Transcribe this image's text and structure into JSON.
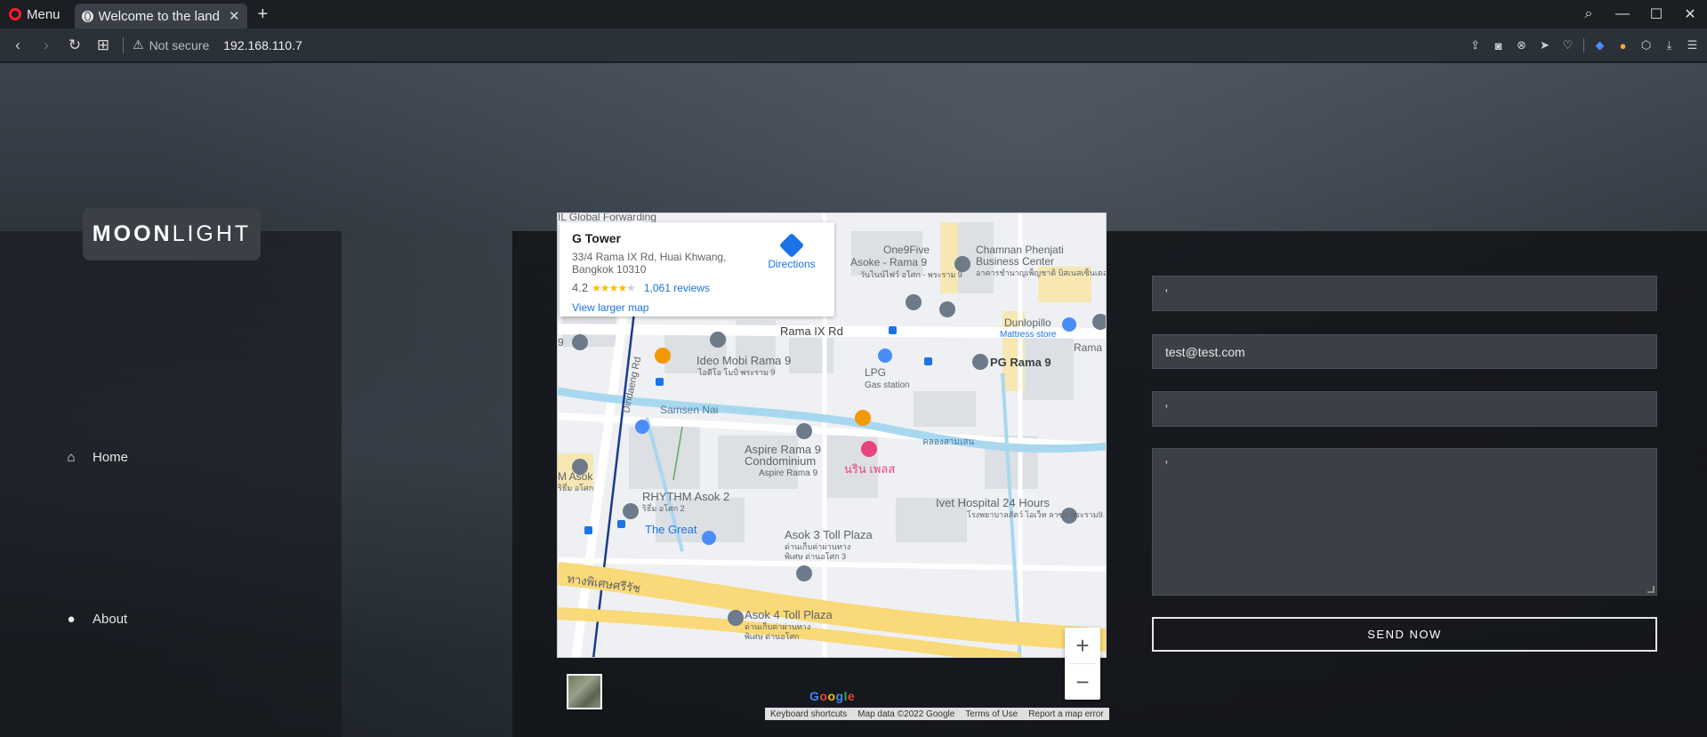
{
  "browser": {
    "menu_label": "Menu",
    "tab_title": "Welcome to the land",
    "security_label": "Not secure",
    "url": "192.168.110.7"
  },
  "site": {
    "brand_bold": "MOON",
    "brand_light": "LIGHT",
    "nav": [
      {
        "label": "Home",
        "icon": "home-icon"
      },
      {
        "label": "About",
        "icon": "user-icon"
      }
    ]
  },
  "map": {
    "place_title": "G Tower",
    "address": "33/4 Rama IX Rd, Huai Khwang, Bangkok 10310",
    "rating": "4.2",
    "stars": 4,
    "reviews": "1,061 reviews",
    "directions_label": "Directions",
    "larger_map_label": "View larger map",
    "labels": {
      "global_forwarding": "IL Global Forwarding",
      "one9five": "One9Five",
      "asoke_rama9": "Asoke - Rama 9",
      "asoke_rama9_th": "วันไนน์ไฟว์ อโศก - พระราม 9",
      "chamnan": "Chamnan Phenjati",
      "business_center": "Business Center",
      "chamnan_th": "อาคารชำนาญเพ็ญชาติ บิสเนสเซ็นเตอร์",
      "dunlopillo": "Dunlopillo",
      "mattress": "Mattress store",
      "rama9_rd": "Rama IX Rd",
      "rama": "Rama",
      "ideo": "Ideo Mobi Rama 9",
      "ideo_th": "ไอดีโอ โมบิ พระราม 9",
      "lpg": "LPG",
      "gas_station": "Gas station",
      "pg_rama9": "PG Rama 9",
      "dindaeng": "Dindaeng Rd",
      "samsen": "Samsen Nai",
      "aspire": "Aspire Rama 9",
      "condominium": "Condominium",
      "aspire_sub": "Aspire Rama 9",
      "narin": "นริน เพลส",
      "m_asok": "M Asok",
      "m_asok_th": "ริธึ่ม อโศก",
      "rhythm": "RHYTHM Asok 2",
      "rhythm_th": "ริธึ่ม อโศก 2",
      "the_great": "The Great",
      "ivet": "Ivet Hospital 24 Hours",
      "ivet_th": "โรงพยาบาลสัตว์ ไอเว็ท ลาซา พระราม9...",
      "asok3": "Asok 3 Toll Plaza",
      "asok3_th1": "ด่านเก็บค่าผ่านทาง",
      "asok3_th2": "พิเศษ ด่านอโศก 3",
      "expressway_th": "ทางพิเศษศรีรัช",
      "asok4": "Asok 4 Toll Plaza",
      "asok4_th1": "ด่านเก็บค่าผ่านทาง",
      "asok4_th2": "พิเศษ ด่านอโศก",
      "klong_th": "คลองสามเสน",
      "num9": "9"
    },
    "footer": [
      "Keyboard shortcuts",
      "Map data ©2022 Google",
      "Terms of Use",
      "Report a map error"
    ],
    "google": [
      "G",
      "o",
      "o",
      "g",
      "l",
      "e"
    ],
    "colors": {
      "road": "#ffffff",
      "water": "#a8d8f0",
      "block": "#dadce0",
      "highway": "#f9d978",
      "pin": "#6c7a89",
      "food": "#f29900",
      "hotel": "#e8437c"
    }
  },
  "form": {
    "name_value": "'",
    "email_value": "test@test.com",
    "subject_value": "'",
    "message_value": "'",
    "send_label": "SEND NOW"
  }
}
